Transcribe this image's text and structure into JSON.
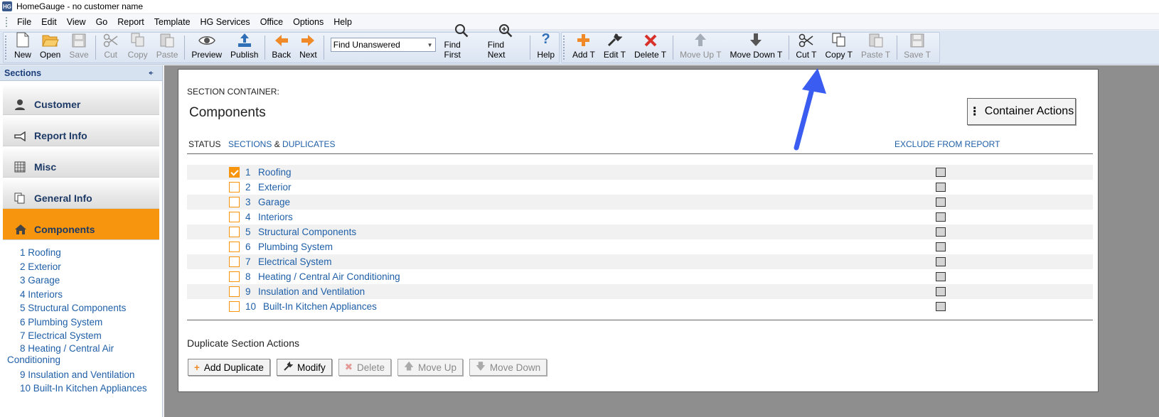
{
  "window": {
    "title": "HomeGauge - no customer name",
    "app_icon": "HG"
  },
  "menu": [
    "File",
    "Edit",
    "View",
    "Go",
    "Report",
    "Template",
    "HG Services",
    "Office",
    "Options",
    "Help"
  ],
  "toolbar": {
    "new": "New",
    "open": "Open",
    "save": "Save",
    "cut": "Cut",
    "copy": "Copy",
    "paste": "Paste",
    "preview": "Preview",
    "publish": "Publish",
    "back": "Back",
    "next": "Next",
    "find_select": "Find Unanswered",
    "find_first": "Find First",
    "find_next": "Find Next",
    "help": "Help",
    "add_t": "Add T",
    "edit_t": "Edit T",
    "delete_t": "Delete T",
    "move_up_t": "Move Up T",
    "move_down_t": "Move Down T",
    "cut_t": "Cut T",
    "copy_t": "Copy T",
    "paste_t": "Paste T",
    "save_t": "Save T"
  },
  "sidebar": {
    "header": "Sections",
    "pin_icon": "⍅",
    "sections": {
      "customer": "Customer",
      "report_info": "Report Info",
      "misc": "Misc",
      "general_info": "General Info",
      "components": "Components"
    },
    "items": [
      "1 Roofing",
      "2 Exterior",
      "3 Garage",
      "4 Interiors",
      "5 Structural Components",
      "6 Plumbing System",
      "7 Electrical System",
      "8 Heating / Central Air Conditioning",
      "9 Insulation and Ventilation",
      "10 Built-In Kitchen Appliances"
    ]
  },
  "main": {
    "section_container_label": "SECTION CONTAINER:",
    "title": "Components",
    "container_actions": "Container Actions",
    "col_status": "STATUS",
    "col_sections": "SECTIONS",
    "col_amp": "&",
    "col_duplicates": "DUPLICATES",
    "col_exclude": "EXCLUDE FROM REPORT",
    "rows": [
      {
        "num": "1",
        "name": "Roofing",
        "checked": true
      },
      {
        "num": "2",
        "name": "Exterior",
        "checked": false
      },
      {
        "num": "3",
        "name": "Garage",
        "checked": false
      },
      {
        "num": "4",
        "name": "Interiors",
        "checked": false
      },
      {
        "num": "5",
        "name": "Structural Components",
        "checked": false
      },
      {
        "num": "6",
        "name": "Plumbing System",
        "checked": false
      },
      {
        "num": "7",
        "name": "Electrical System",
        "checked": false
      },
      {
        "num": "8",
        "name": "Heating / Central Air Conditioning",
        "checked": false
      },
      {
        "num": "9",
        "name": "Insulation and Ventilation",
        "checked": false
      },
      {
        "num": "10",
        "name": "Built-In Kitchen Appliances",
        "checked": false
      }
    ],
    "dup_title": "Duplicate Section Actions",
    "dup_add": "Add Duplicate",
    "dup_modify": "Modify",
    "dup_delete": "Delete",
    "dup_move_up": "Move Up",
    "dup_move_down": "Move Down"
  },
  "colors": {
    "accent_orange": "#f7960e",
    "link_blue": "#1f5fa8",
    "annotation_arrow": "#3a5cf0"
  }
}
